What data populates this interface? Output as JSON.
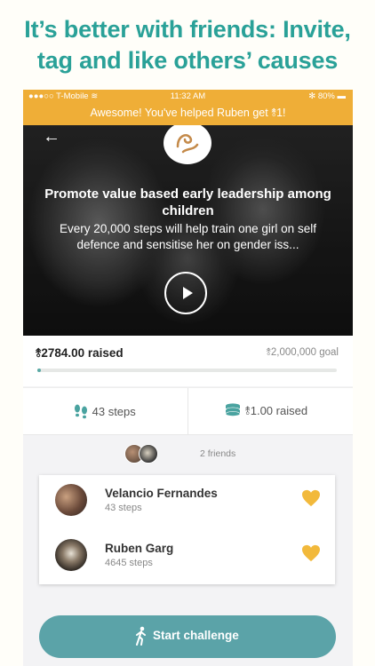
{
  "headline": {
    "line1": "It’s better with friends: Invite,",
    "line2": "tag and like others’ causes"
  },
  "status_bar": {
    "carrier": "●●●○○ T-Mobile ≋",
    "time": "11:32 AM",
    "battery": "✻ 80% ▬"
  },
  "banner": {
    "text": "Awesome! You've helped Ruben get ⥉1!"
  },
  "cause": {
    "title": "Promote value based early leadership among children",
    "description": "Every 20,000 steps will help train one girl on self defence and sensitise her on gender iss..."
  },
  "fundraising": {
    "raised": "⥉2784.00 raised",
    "goal": "⥉2,000,000 goal",
    "progress_fraction": 0.0014
  },
  "stats": {
    "steps": "43 steps",
    "raised": "⥉1.00 raised"
  },
  "friends": {
    "count_label": "2 friends",
    "list": [
      {
        "name": "Velancio Fernandes",
        "steps": "43 steps"
      },
      {
        "name": "Ruben Garg",
        "steps": "4645 steps"
      }
    ]
  },
  "cta": {
    "label": "Start challenge"
  },
  "colors": {
    "accent": "#efae37",
    "teal": "#5ba3a8",
    "headline": "#2aa198",
    "heart": "#f2b93b"
  },
  "icons": [
    "back-arrow-icon",
    "charity-logo-icon",
    "play-icon",
    "footsteps-icon",
    "coins-icon",
    "heart-icon",
    "walking-person-icon"
  ]
}
